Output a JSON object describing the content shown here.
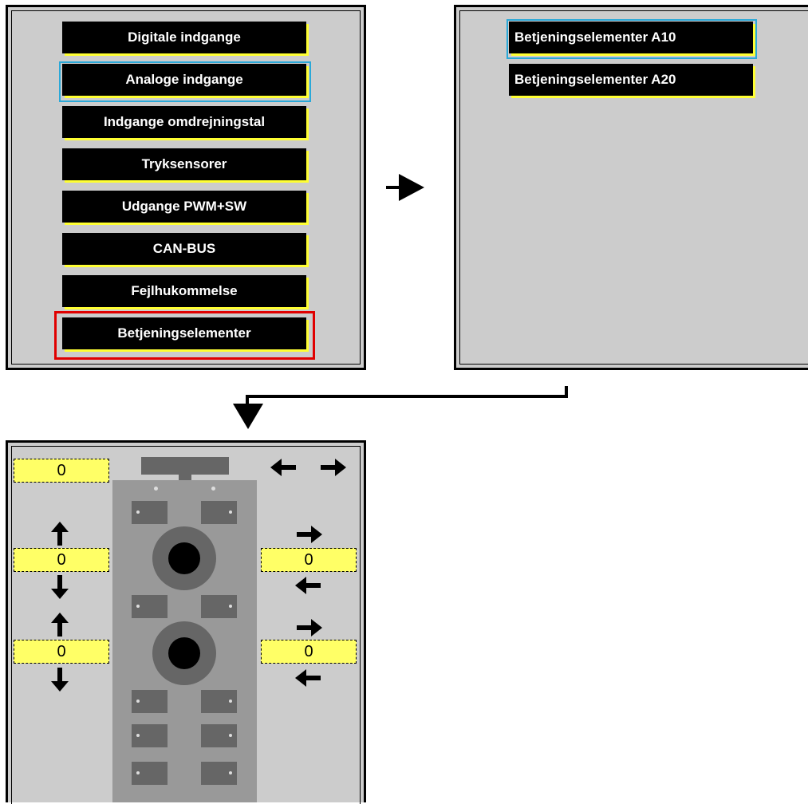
{
  "menu": {
    "items": [
      "Digitale indgange",
      "Analoge indgange",
      "Indgange omdrejningstal",
      "Tryksensorer",
      "Udgange PWM+SW",
      "CAN-BUS",
      "Fejlhukommelse",
      "Betjeningselementer"
    ]
  },
  "submenu": {
    "items": [
      "Betjeningselementer A10",
      "Betjeningselementer A20"
    ]
  },
  "controls": {
    "top_value": "0",
    "left_value_1": "0",
    "left_value_2": "0",
    "right_value_1": "0",
    "right_value_2": "0",
    "arrow_left": "🡄",
    "arrow_right": "🡆",
    "arrow_up": "🡅",
    "arrow_down": "🡇"
  },
  "colors": {
    "panel_bg": "#cccccc",
    "button_bg": "#000000",
    "button_shadow": "#ffff33",
    "selected_outline": "#e00000",
    "focus_outline": "#2aa8d8",
    "value_bg": "#ffff66"
  }
}
